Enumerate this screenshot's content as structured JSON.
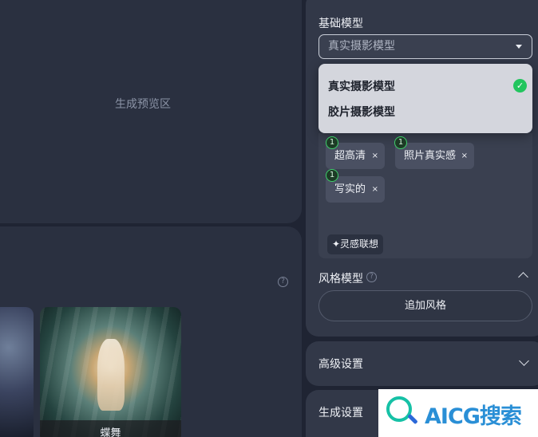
{
  "preview": {
    "label": "生成预览区"
  },
  "gallery": {
    "help_icon": "?",
    "items": [
      {
        "caption": ""
      },
      {
        "caption": "蝶舞"
      }
    ]
  },
  "base_model": {
    "title": "基础模型",
    "selected": "真实摄影模型",
    "options": [
      {
        "label": "真实摄影模型",
        "checked": true
      },
      {
        "label": "胶片摄影模型",
        "checked": false
      }
    ]
  },
  "tags": [
    {
      "badge": "1",
      "label": "超高清",
      "remove": "×"
    },
    {
      "badge": "1",
      "label": "照片真实感",
      "remove": "×"
    },
    {
      "badge": "1",
      "label": "写实的",
      "remove": "×"
    }
  ],
  "inspire_button": "✦灵感联想",
  "style_model": {
    "title": "风格模型",
    "help_icon": "?",
    "add_button": "追加风格"
  },
  "advanced": {
    "title": "高级设置"
  },
  "generate": {
    "title": "生成设置"
  },
  "watermark": {
    "text": "AICG搜索"
  },
  "colors": {
    "accent": "#22c55e",
    "panel": "#323848",
    "background": "#1f2433"
  }
}
